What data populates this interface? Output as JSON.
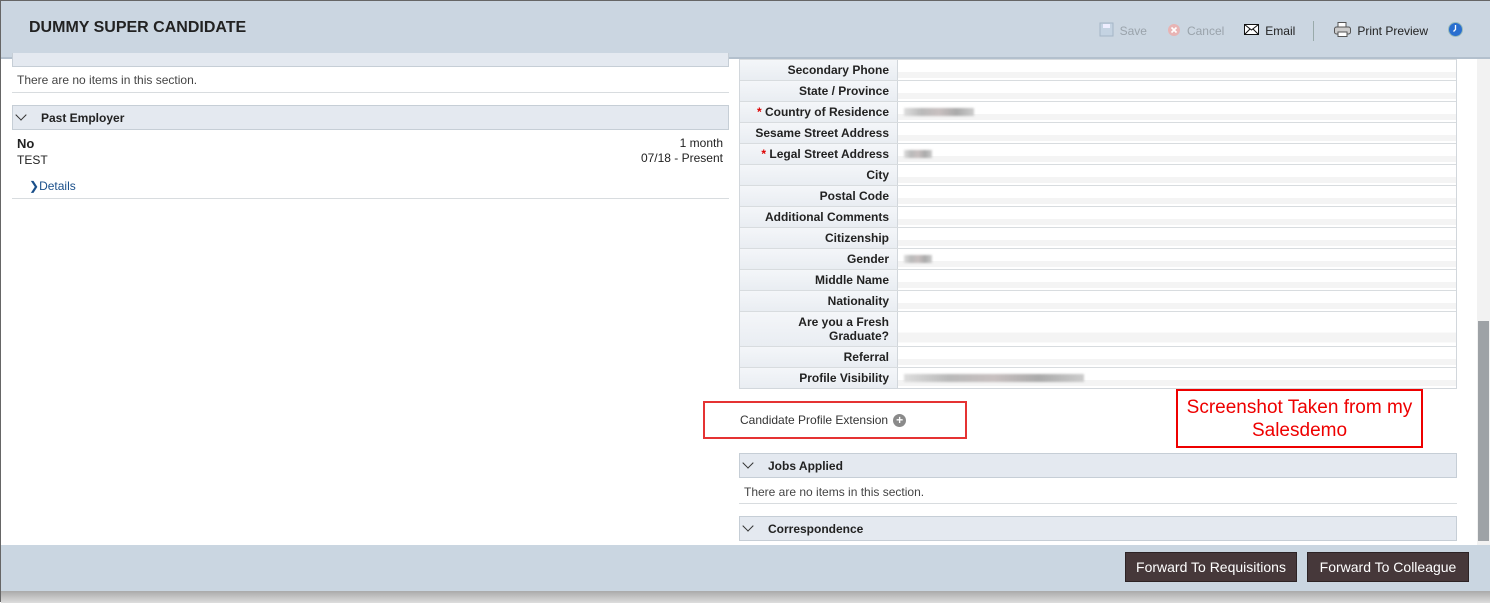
{
  "header": {
    "title": "DUMMY SUPER CANDIDATE",
    "toolbar": {
      "save": "Save",
      "cancel": "Cancel",
      "email": "Email",
      "print_preview": "Print Preview"
    }
  },
  "left": {
    "empty_text": "There are no items in this section.",
    "past_employer": {
      "title": "Past Employer",
      "name": "No",
      "title_value": "TEST",
      "duration": "1 month",
      "dates": "07/18 - Present",
      "details_link": "Details"
    }
  },
  "profile_fields": [
    {
      "label": "Secondary Phone"
    },
    {
      "label": "State / Province"
    },
    {
      "label": "Country of Residence",
      "required": true
    },
    {
      "label": "Sesame Street Address"
    },
    {
      "label": "Legal Street Address",
      "required": true
    },
    {
      "label": "City"
    },
    {
      "label": "Postal Code"
    },
    {
      "label": "Additional Comments"
    },
    {
      "label": "Citizenship"
    },
    {
      "label": "Gender"
    },
    {
      "label": "Middle Name"
    },
    {
      "label": "Nationality"
    },
    {
      "label": "Are you a Fresh Graduate?"
    },
    {
      "label": "Referral"
    },
    {
      "label": "Profile Visibility"
    }
  ],
  "required_marker": "*",
  "extension": {
    "label": "Candidate Profile Extension",
    "icon": "plus-circle-icon"
  },
  "annotation": "Screenshot Taken from my Salesdemo",
  "jobs_applied": {
    "title": "Jobs Applied",
    "empty_text": "There are no items in this section."
  },
  "correspondence": {
    "title": "Correspondence"
  },
  "footer": {
    "forward_requisitions": "Forward To Requisitions",
    "forward_colleague": "Forward To Colleague"
  }
}
